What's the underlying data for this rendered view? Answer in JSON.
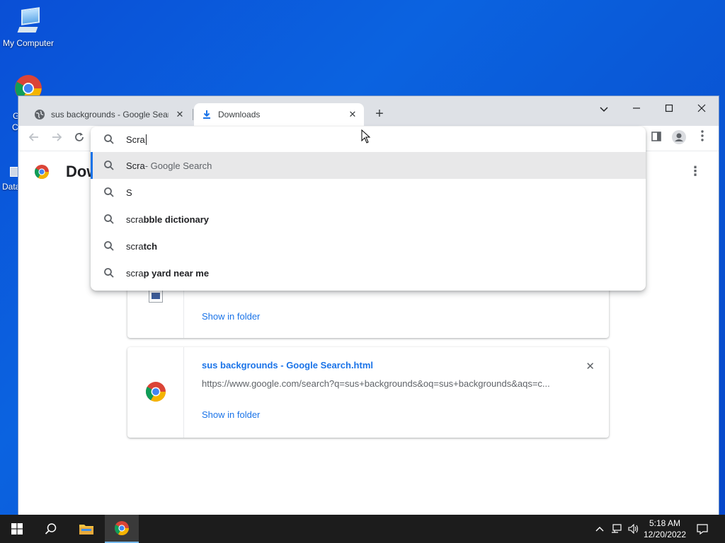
{
  "desktop": {
    "icons": [
      {
        "label": "My Computer"
      },
      {
        "label": "G"
      },
      {
        "label": "C"
      },
      {
        "label": "Data"
      }
    ]
  },
  "browser": {
    "tabs": [
      {
        "title": "sus backgrounds - Google Search",
        "icon": "globe-icon"
      },
      {
        "title": "Downloads",
        "icon": "download-icon"
      }
    ],
    "new_tab_label": "+",
    "omnibox": {
      "input_value": "Scra",
      "suggestions": [
        {
          "typed": "Scra",
          "rest": " - Google Search",
          "bold": false,
          "selected": true
        },
        {
          "typed": "S",
          "rest": "",
          "bold": false,
          "selected": false
        },
        {
          "typed": "scra",
          "rest": "bble dictionary",
          "bold": true,
          "selected": false
        },
        {
          "typed": "scra",
          "rest": "tch",
          "bold": true,
          "selected": false
        },
        {
          "typed": "scra",
          "rest": "p yard near me",
          "bold": true,
          "selected": false
        }
      ]
    }
  },
  "page": {
    "title": "Dow",
    "downloads": [
      {
        "file_name": "",
        "url": "",
        "show_in_folder": "Show in folder"
      },
      {
        "file_name": "sus backgrounds - Google Search.html",
        "url": "https://www.google.com/search?q=sus+backgrounds&oq=sus+backgrounds&aqs=c...",
        "show_in_folder": "Show in folder"
      }
    ]
  },
  "taskbar": {
    "time": "5:18 AM",
    "date": "12/20/2022"
  },
  "colors": {
    "accent": "#1a73e8",
    "desktop_bg": "#0a5ad8",
    "taskbar_bg": "#1c1c1c"
  }
}
